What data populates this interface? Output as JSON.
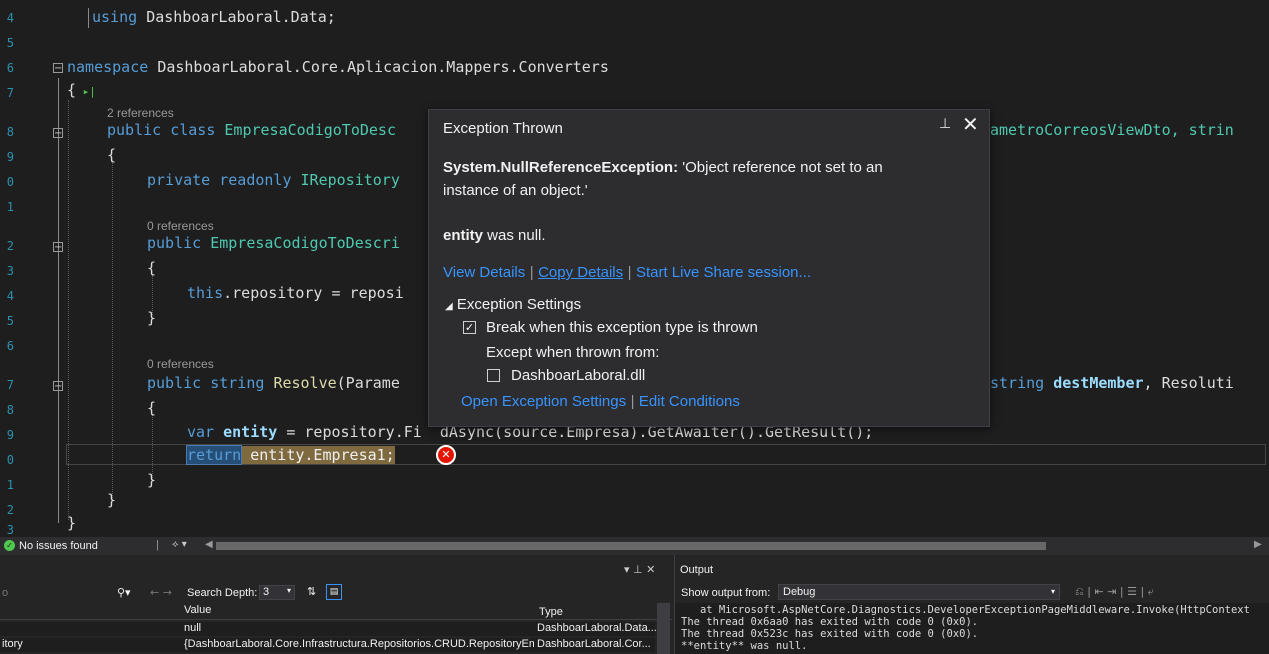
{
  "editor": {
    "line_numbers": [
      "4",
      "5",
      "6",
      "7",
      "8",
      "9",
      "0",
      "1",
      "2",
      "3",
      "4",
      "5",
      "6",
      "7",
      "8",
      "9",
      "0",
      "1",
      "2",
      "3"
    ],
    "code": {
      "using_kw": "using",
      "using_ns": "DashboarLaboral.Data;",
      "namespace_kw": "namespace",
      "namespace_name": "DashboarLaboral.Core.Aplicacion.Mappers.Converters",
      "open_brace": "{",
      "refs_2": "2 references",
      "class_public": "public",
      "class_kw": "class",
      "class_name": "EmpresaCodigoToDesc",
      "class_tail": "ametroCorreosViewDto, strin",
      "brace_open_1": "{",
      "field_private": "private",
      "field_readonly": "readonly",
      "field_type": "IRepository",
      "refs_0a": "0 references",
      "ctor_public": "public",
      "ctor_name": "EmpresaCodigoToDescri",
      "brace_open_2": "{",
      "assign_this": "this",
      "assign_rest": ".repository = reposi",
      "brace_close_2": "}",
      "refs_0b": "0 references",
      "method_public": "public",
      "method_string": "string",
      "method_name": "Resolve",
      "method_params": "(Parame",
      "method_tail_kw": "string",
      "method_tail_id": "destMember",
      "method_tail_rest": ", Resoluti",
      "brace_open_3": "{",
      "var_kw": "var",
      "var_name": "entity",
      "var_rest": " = repository.Fi  dAsync(source.Empresa).GetAwaiter().GetResult();",
      "return_kw": "return",
      "return_expr": " entity.Empresa1;",
      "brace_close_3": "}",
      "brace_close_1": "}",
      "brace_close_0": "}"
    },
    "error_icon": "error-circle-icon"
  },
  "popup": {
    "title": "Exception Thrown",
    "exception_type": "System.NullReferenceException:",
    "exception_msg_1": " 'Object reference not set to an",
    "exception_msg_2": "instance of an object.'",
    "var_name": "entity",
    "var_msg": " was null.",
    "links": {
      "view_details": "View Details",
      "copy_details": "Copy Details",
      "live_share": "Start Live Share session..."
    },
    "settings_header": "Exception Settings",
    "break_label": "Break when this exception type is thrown",
    "break_checked": true,
    "except_label": "Except when thrown from:",
    "dll_label": "DashboarLaboral.dll",
    "dll_checked": false,
    "open_settings": "Open Exception Settings",
    "edit_conditions": "Edit Conditions",
    "pin_icon": "pin-icon",
    "close_icon": "close-icon"
  },
  "statusbar": {
    "issues": "No issues found",
    "issues_icon": "check-circle-icon"
  },
  "locals": {
    "search_depth_label": "Search Depth:",
    "search_depth_value": "3",
    "col_value": "Value",
    "col_type": "Type",
    "rows": [
      {
        "name": "",
        "value": "null",
        "type": "DashboarLaboral.Data..."
      },
      {
        "name": "itory",
        "value": "{DashboarLaboral.Core.Infrastructura.Repositorios.CRUD.RepositoryEm...",
        "type": "DashboarLaboral.Cor..."
      }
    ],
    "left_stub": "o"
  },
  "output": {
    "title": "Output",
    "show_from_label": "Show output from:",
    "show_from_value": "Debug",
    "lines": [
      "   at Microsoft.AspNetCore.Diagnostics.DeveloperExceptionPageMiddleware.Invoke(HttpContext",
      "The thread 0x6aa0 has exited with code 0 (0x0).",
      "The thread 0x523c has exited with code 0 (0x0).",
      "**entity** was null."
    ]
  },
  "colors": {
    "editor_bg": "#1e1e1e",
    "keyword": "#569cd6",
    "type": "#4ec9b0",
    "link": "#3794ff",
    "error": "#e51400"
  }
}
